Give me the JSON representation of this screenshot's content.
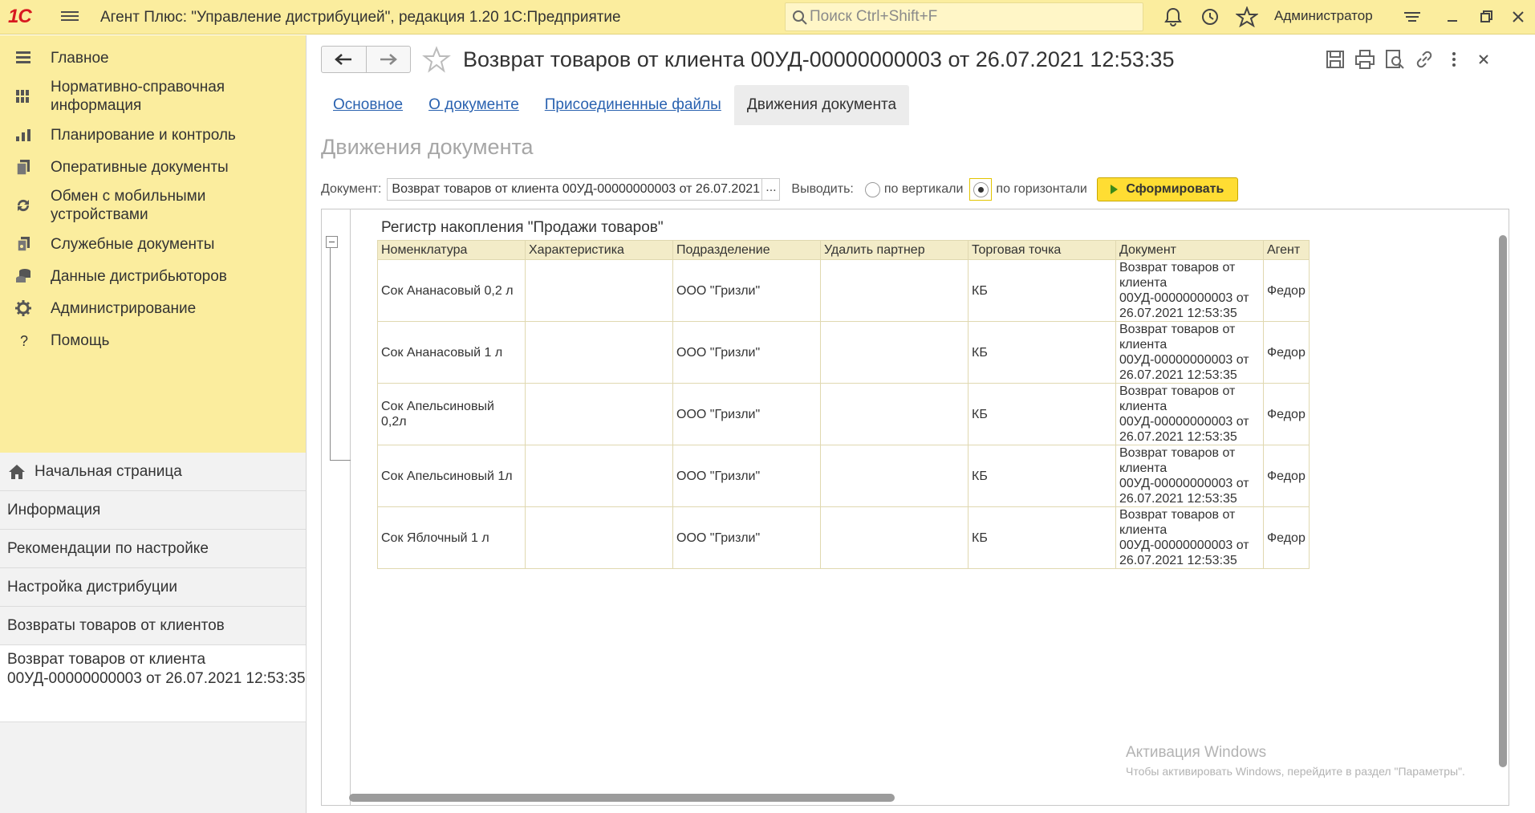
{
  "app": {
    "logo": "1С",
    "title": "Агент Плюс: \"Управление дистрибуцией\", редакция 1.20 1С:Предприятие",
    "search_placeholder": "Поиск Ctrl+Shift+F",
    "user": "Администратор"
  },
  "sidebar": {
    "sections": [
      {
        "label": "Главное",
        "icon": "menu-lines-icon"
      },
      {
        "label": "Нормативно-справочная информация",
        "icon": "catalog-grid-icon"
      },
      {
        "label": "Планирование и контроль",
        "icon": "bar-chart-icon"
      },
      {
        "label": "Оперативные документы",
        "icon": "documents-icon"
      },
      {
        "label": "Обмен с мобильными устройствами",
        "icon": "sync-icon"
      },
      {
        "label": "Служебные документы",
        "icon": "service-docs-icon"
      },
      {
        "label": "Данные дистрибьюторов",
        "icon": "database-icon"
      },
      {
        "label": "Администрирование",
        "icon": "gear-icon"
      },
      {
        "label": "Помощь",
        "icon": "question-icon"
      }
    ],
    "open_windows": [
      {
        "label": "Начальная страница"
      },
      {
        "label": "Информация"
      },
      {
        "label": "Рекомендации по настройке"
      },
      {
        "label": "Настройка дистрибуции"
      },
      {
        "label": "Возвраты товаров от клиентов"
      },
      {
        "label": "Возврат товаров от клиента 00УД-00000000003 от 26.07.2021 12:53:35"
      }
    ]
  },
  "document": {
    "title": "Возврат товаров от клиента 00УД-00000000003 от 26.07.2021 12:53:35",
    "tabs": [
      {
        "label": "Основное"
      },
      {
        "label": "О документе"
      },
      {
        "label": "Присоединенные файлы"
      },
      {
        "label": "Движения документа"
      }
    ],
    "active_tab": "Движения документа",
    "section_title": "Движения документа"
  },
  "filter": {
    "doc_label": "Документ:",
    "doc_value": "Возврат товаров от клиента 00УД-00000000003 от 26.07.2021",
    "doc_select": "...",
    "output_label": "Выводить:",
    "option_vertical": "по вертикали",
    "option_horizontal": "по горизонтали",
    "selected": "по горизонтали",
    "form_button": "Сформировать"
  },
  "report": {
    "register_title": "Регистр накопления \"Продажи товаров\"",
    "columns": [
      "Номенклатура",
      "Характеристика",
      "Подразделение",
      "Удалить партнер",
      "Торговая точка",
      "Документ",
      "Агент"
    ],
    "rows": [
      {
        "nomenclature": "Сок Ананасовый 0,2 л",
        "characteristic": "",
        "division": "ООО \"Гризли\"",
        "partner": "",
        "outlet": "КБ",
        "document": "Возврат товаров от клиента 00УД-00000000003 от 26.07.2021 12:53:35",
        "agent": "Федор"
      },
      {
        "nomenclature": "Сок Ананасовый 1 л",
        "characteristic": "",
        "division": "ООО \"Гризли\"",
        "partner": "",
        "outlet": "КБ",
        "document": "Возврат товаров от клиента 00УД-00000000003 от 26.07.2021 12:53:35",
        "agent": "Федор"
      },
      {
        "nomenclature": "Сок Апельсиновый 0,2л",
        "characteristic": "",
        "division": "ООО \"Гризли\"",
        "partner": "",
        "outlet": "КБ",
        "document": "Возврат товаров от клиента 00УД-00000000003 от 26.07.2021 12:53:35",
        "agent": "Федор"
      },
      {
        "nomenclature": "Сок Апельсиновый 1л",
        "characteristic": "",
        "division": "ООО \"Гризли\"",
        "partner": "",
        "outlet": "КБ",
        "document": "Возврат товаров от клиента 00УД-00000000003 от 26.07.2021 12:53:35",
        "agent": "Федор"
      },
      {
        "nomenclature": "Сок Яблочный 1 л",
        "characteristic": "",
        "division": "ООО \"Гризли\"",
        "partner": "",
        "outlet": "КБ",
        "document": "Возврат товаров от клиента 00УД-00000000003 от 26.07.2021 12:53:35",
        "agent": "Федор"
      }
    ]
  },
  "watermark": {
    "line1": "Активация Windows",
    "line2": "Чтобы активировать Windows, перейдите в раздел \"Параметры\"."
  },
  "colors": {
    "accent_yellow": "#fbed9e",
    "button_yellow": "#ffdd33",
    "link_blue": "#2a62b0",
    "header_row": "#f3ecc8"
  }
}
